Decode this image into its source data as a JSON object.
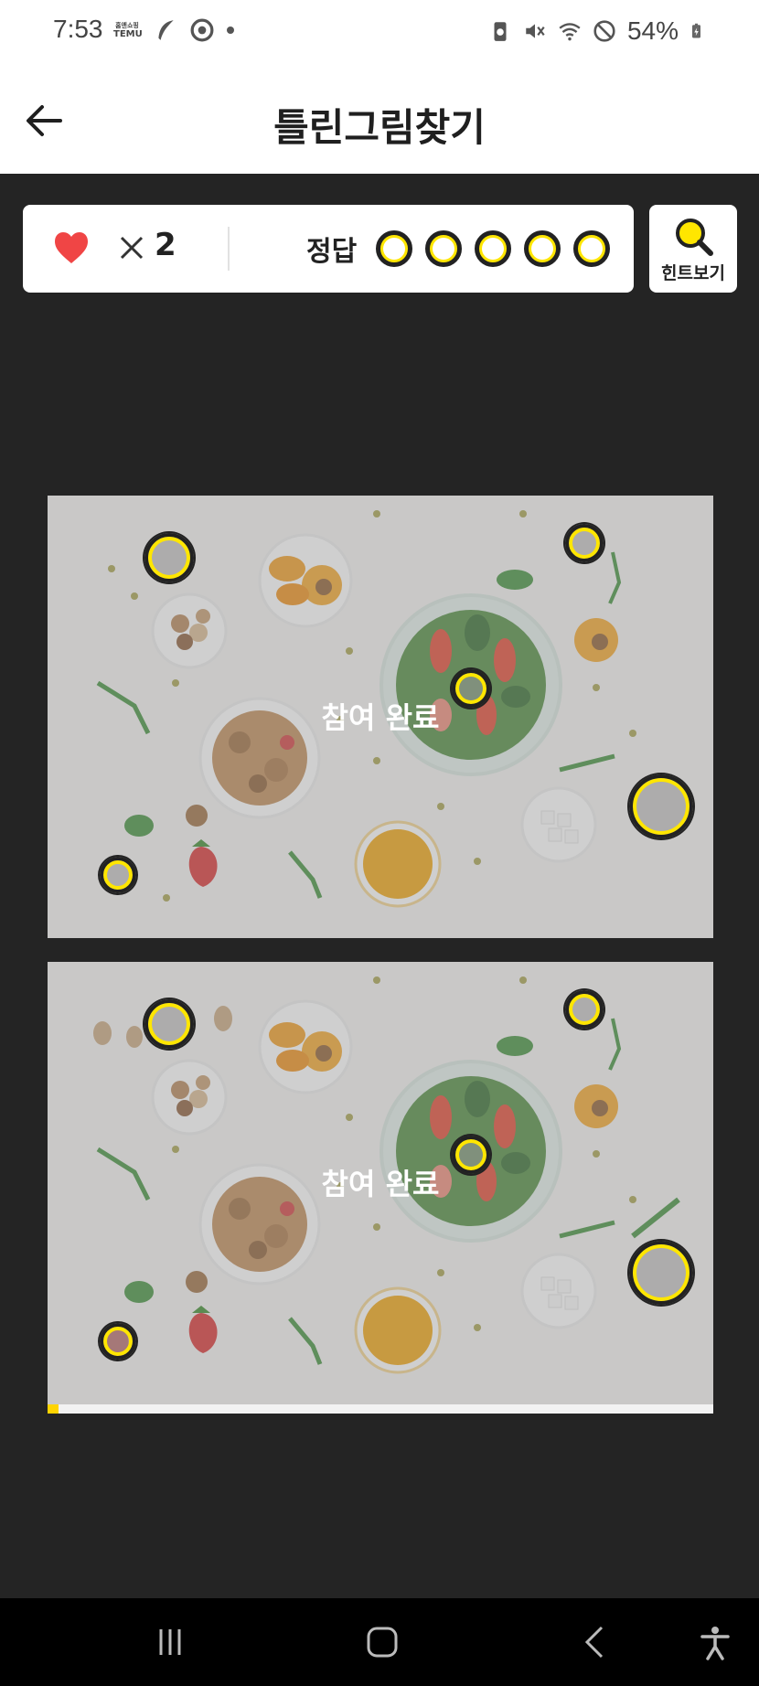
{
  "status_bar": {
    "time": "7:53",
    "temu_label": "TEMU",
    "temu_top": "홈앤쇼핑",
    "battery": "54%",
    "left_icons": [
      "temu-icon",
      "feather-icon",
      "chrome-icon",
      "dot-icon"
    ],
    "right_icons": [
      "battery-saver-icon",
      "mute-icon",
      "wifi-icon",
      "dnd-icon",
      "battery-icon"
    ]
  },
  "header": {
    "title": "틀린그림찾기",
    "back_icon": "arrow-left-icon"
  },
  "score": {
    "lives_count": "2",
    "answer_label": "정답",
    "answer_slots": 5,
    "colors": {
      "heart": "#f04545",
      "slot": "#ffe600"
    }
  },
  "hint": {
    "label": "힌트보기",
    "icon": "magnifier-icon"
  },
  "game": {
    "overlay_text": "참여 완료",
    "progress": 0.016,
    "accent": "#ffd400"
  },
  "navbar": {
    "icons": [
      "recent-apps-icon",
      "home-icon",
      "back-icon",
      "accessibility-icon"
    ]
  }
}
